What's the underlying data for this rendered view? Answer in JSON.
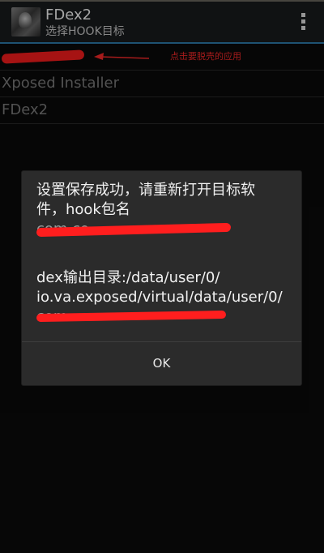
{
  "app": {
    "title": "FDex2",
    "subtitle": "选择HOOK目标"
  },
  "list": {
    "items": [
      {
        "label": "",
        "redacted": true
      },
      {
        "label": "Xposed Installer"
      },
      {
        "label": "FDex2"
      }
    ],
    "annotation_text": "点击要脱壳的应用"
  },
  "dialog": {
    "message_lines_part1": [
      "设置保存成功，请重新打开目标软",
      "件，hook包名",
      "com.co..."
    ],
    "message_lines_part2": [
      "dex输出目录:/data/user/0/",
      "io.va.exposed/virtual/data/user/0/",
      "com..."
    ],
    "ok_label": "OK"
  },
  "colors": {
    "accent": "#2f7fb0",
    "annotation": "#ff2a2a",
    "redaction": "#ff1e1e"
  }
}
